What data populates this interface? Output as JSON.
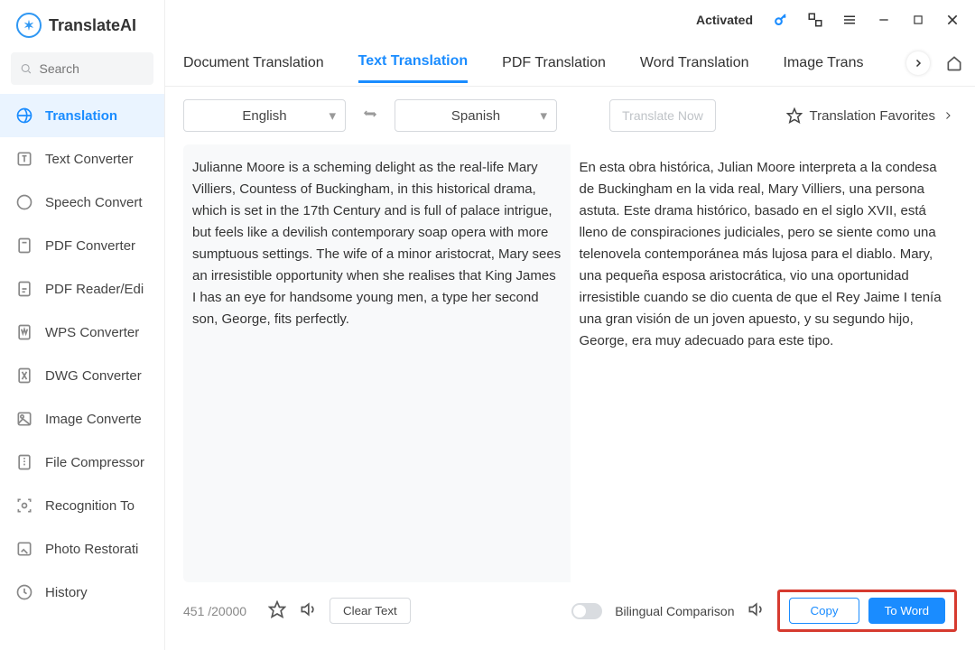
{
  "app": {
    "name": "TranslateAI",
    "status": "Activated",
    "search_placeholder": "Search"
  },
  "sidebar": {
    "items": [
      {
        "label": "Translation"
      },
      {
        "label": "Text Converter"
      },
      {
        "label": "Speech Convert"
      },
      {
        "label": "PDF Converter"
      },
      {
        "label": "PDF Reader/Edi"
      },
      {
        "label": "WPS Converter"
      },
      {
        "label": "DWG Converter"
      },
      {
        "label": "Image Converte"
      },
      {
        "label": "File Compressor"
      },
      {
        "label": "Recognition To"
      },
      {
        "label": "Photo Restorati"
      },
      {
        "label": "History"
      }
    ]
  },
  "tabs": [
    "Document Translation",
    "Text Translation",
    "PDF Translation",
    "Word Translation",
    "Image Trans"
  ],
  "langs": {
    "source": "English",
    "target": "Spanish",
    "translate_btn": "Translate Now",
    "favorites": "Translation Favorites"
  },
  "source_text": "Julianne Moore is a scheming delight as the real-life Mary Villiers, Countess of Buckingham, in this historical drama, which is set in the 17th Century and is full of palace intrigue, but feels like a devilish contemporary soap opera with more sumptuous settings. The wife of a minor aristocrat, Mary sees an irresistible opportunity when she realises that King James I has an eye for handsome young men, a type her second son, George, fits perfectly.",
  "target_text": "En esta obra histórica, Julian Moore interpreta a la condesa de Buckingham en la vida real, Mary Villiers, una persona astuta. Este drama histórico, basado en el siglo XVII, está lleno de conspiraciones judiciales, pero se siente como una telenovela contemporánea más lujosa para el diablo. Mary, una pequeña esposa aristocrática, vio una oportunidad irresistible cuando se dio cuenta de que el Rey Jaime I tenía una gran visión de un joven apuesto, y su segundo hijo, George, era muy adecuado para este tipo.",
  "footer": {
    "count": "451 /20000",
    "clear": "Clear Text",
    "bilingual": "Bilingual Comparison",
    "copy": "Copy",
    "to_word": "To Word"
  }
}
